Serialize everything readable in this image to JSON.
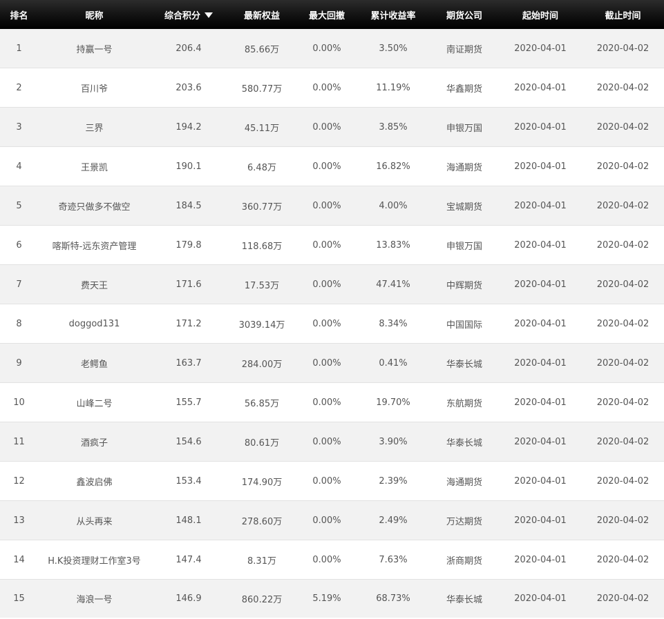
{
  "table": {
    "headers": {
      "rank": "排名",
      "nickname": "昵称",
      "score": "综合积分",
      "equity": "最新权益",
      "drawdown": "最大回撤",
      "return": "累计收益率",
      "company": "期货公司",
      "start": "起始时间",
      "end": "截止时间"
    },
    "sort_icon": "sort-desc-triangle-icon",
    "rows": [
      {
        "rank": "1",
        "nickname": "持赢一号",
        "score": "206.4",
        "equity": "85.66万",
        "drawdown": "0.00%",
        "return": "3.50%",
        "company": "南证期货",
        "start": "2020-04-01",
        "end": "2020-04-02"
      },
      {
        "rank": "2",
        "nickname": "百川爷",
        "score": "203.6",
        "equity": "580.77万",
        "drawdown": "0.00%",
        "return": "11.19%",
        "company": "华鑫期货",
        "start": "2020-04-01",
        "end": "2020-04-02"
      },
      {
        "rank": "3",
        "nickname": "三界",
        "score": "194.2",
        "equity": "45.11万",
        "drawdown": "0.00%",
        "return": "3.85%",
        "company": "申银万国",
        "start": "2020-04-01",
        "end": "2020-04-02"
      },
      {
        "rank": "4",
        "nickname": "王景凯",
        "score": "190.1",
        "equity": "6.48万",
        "drawdown": "0.00%",
        "return": "16.82%",
        "company": "海通期货",
        "start": "2020-04-01",
        "end": "2020-04-02"
      },
      {
        "rank": "5",
        "nickname": "奇迹只做多不做空",
        "score": "184.5",
        "equity": "360.77万",
        "drawdown": "0.00%",
        "return": "4.00%",
        "company": "宝城期货",
        "start": "2020-04-01",
        "end": "2020-04-02"
      },
      {
        "rank": "6",
        "nickname": "喀斯特-远东资产管理",
        "score": "179.8",
        "equity": "118.68万",
        "drawdown": "0.00%",
        "return": "13.83%",
        "company": "申银万国",
        "start": "2020-04-01",
        "end": "2020-04-02"
      },
      {
        "rank": "7",
        "nickname": "费天王",
        "score": "171.6",
        "equity": "17.53万",
        "drawdown": "0.00%",
        "return": "47.41%",
        "company": "中辉期货",
        "start": "2020-04-01",
        "end": "2020-04-02"
      },
      {
        "rank": "8",
        "nickname": "doggod131",
        "score": "171.2",
        "equity": "3039.14万",
        "drawdown": "0.00%",
        "return": "8.34%",
        "company": "中国国际",
        "start": "2020-04-01",
        "end": "2020-04-02"
      },
      {
        "rank": "9",
        "nickname": "老鳄鱼",
        "score": "163.7",
        "equity": "284.00万",
        "drawdown": "0.00%",
        "return": "0.41%",
        "company": "华泰长城",
        "start": "2020-04-01",
        "end": "2020-04-02"
      },
      {
        "rank": "10",
        "nickname": "山峰二号",
        "score": "155.7",
        "equity": "56.85万",
        "drawdown": "0.00%",
        "return": "19.70%",
        "company": "东航期货",
        "start": "2020-04-01",
        "end": "2020-04-02"
      },
      {
        "rank": "11",
        "nickname": "酒疯子",
        "score": "154.6",
        "equity": "80.61万",
        "drawdown": "0.00%",
        "return": "3.90%",
        "company": "华泰长城",
        "start": "2020-04-01",
        "end": "2020-04-02"
      },
      {
        "rank": "12",
        "nickname": "鑫波启佛",
        "score": "153.4",
        "equity": "174.90万",
        "drawdown": "0.00%",
        "return": "2.39%",
        "company": "海通期货",
        "start": "2020-04-01",
        "end": "2020-04-02"
      },
      {
        "rank": "13",
        "nickname": "从头再来",
        "score": "148.1",
        "equity": "278.60万",
        "drawdown": "0.00%",
        "return": "2.49%",
        "company": "万达期货",
        "start": "2020-04-01",
        "end": "2020-04-02"
      },
      {
        "rank": "14",
        "nickname": "H.K投资理财工作室3号",
        "score": "147.4",
        "equity": "8.31万",
        "drawdown": "0.00%",
        "return": "7.63%",
        "company": "浙商期货",
        "start": "2020-04-01",
        "end": "2020-04-02"
      },
      {
        "rank": "15",
        "nickname": "海浪一号",
        "score": "146.9",
        "equity": "860.22万",
        "drawdown": "5.19%",
        "return": "68.73%",
        "company": "华泰长城",
        "start": "2020-04-01",
        "end": "2020-04-02"
      }
    ]
  }
}
